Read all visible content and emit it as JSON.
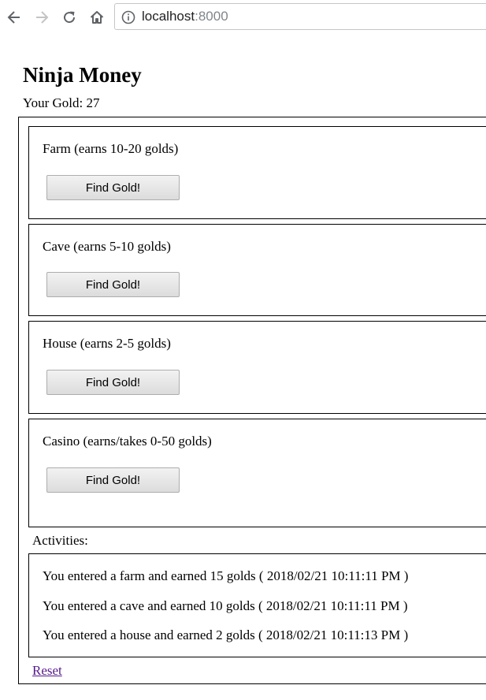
{
  "browser": {
    "url_host": "localhost",
    "url_port": ":8000",
    "icons": [
      "back-icon",
      "forward-icon",
      "reload-icon",
      "home-icon",
      "info-icon"
    ]
  },
  "page": {
    "title": "Ninja Money",
    "gold_label": "Your Gold: 27"
  },
  "places": [
    {
      "label": "Farm (earns 10-20 golds)",
      "button": "Find Gold!"
    },
    {
      "label": "Cave (earns 5-10 golds)",
      "button": "Find Gold!"
    },
    {
      "label": "House (earns 2-5 golds)",
      "button": "Find Gold!"
    },
    {
      "label": "Casino (earns/takes 0-50 golds)",
      "button": "Find Gold!"
    }
  ],
  "activities": {
    "label": "Activities:",
    "log": [
      "You entered a farm and earned 15 golds ( 2018/02/21 10:11:11 PM )",
      "You entered a cave and earned 10 golds ( 2018/02/21 10:11:11 PM )",
      "You entered a house and earned 2 golds ( 2018/02/21 10:11:13 PM )"
    ]
  },
  "reset_label": "Reset"
}
